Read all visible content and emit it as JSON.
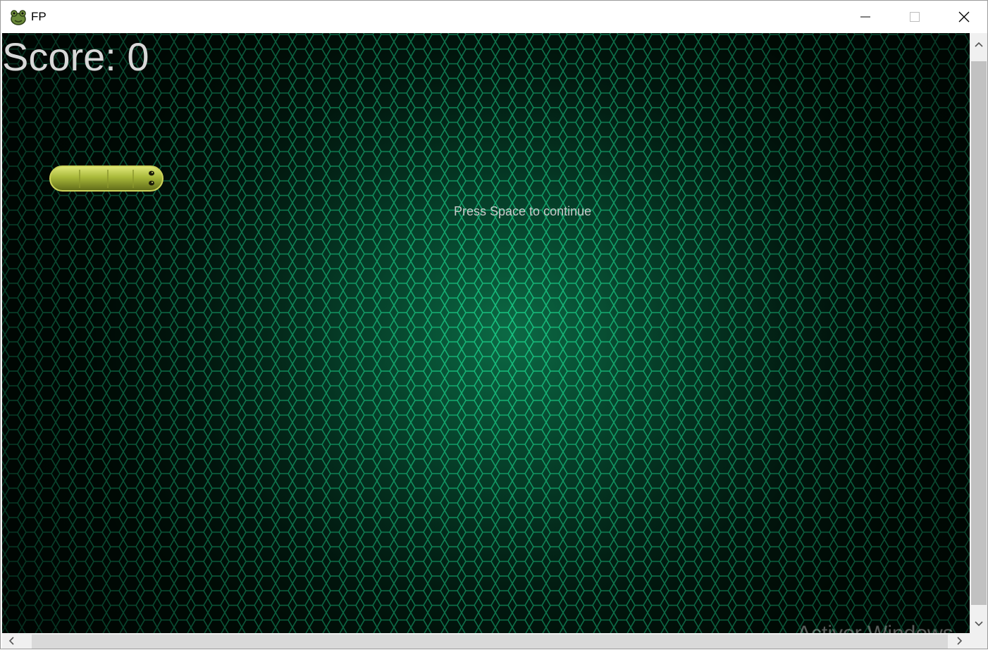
{
  "window": {
    "title": "FP",
    "app_icon": "frog-icon",
    "controls": {
      "minimize": "minimize-icon",
      "maximize": "maximize-icon",
      "close": "close-icon"
    }
  },
  "game": {
    "score_text": "Score: 0",
    "prompt": "Press Space to continue",
    "snake": "snake-sprite",
    "background": "green-hexagon-grid"
  },
  "watermark": "Activer Windows",
  "colors": {
    "hex_stroke": "#19d08a",
    "score_text": "#d8d8d8",
    "snake_body": "#a8b83a"
  }
}
